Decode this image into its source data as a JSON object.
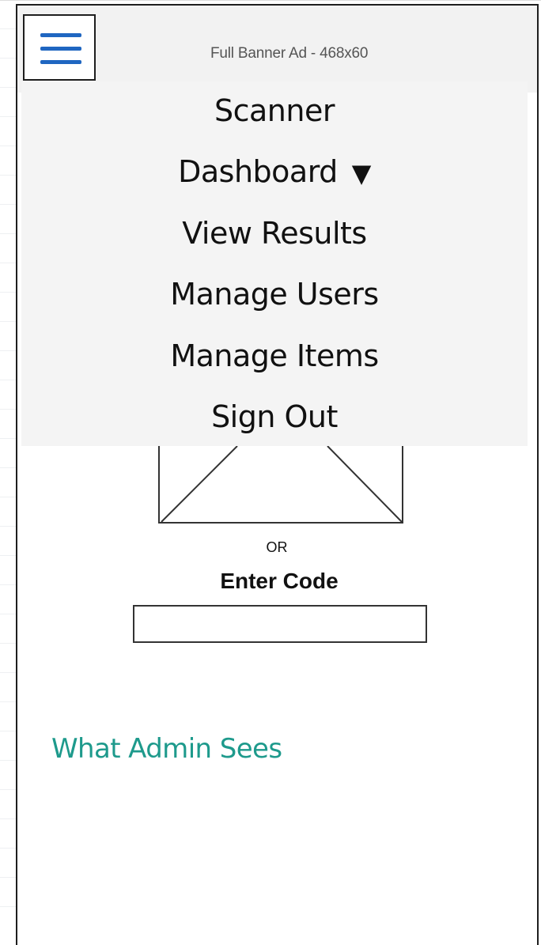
{
  "banner": {
    "text": "Full Banner Ad - 468x60"
  },
  "menu": {
    "items": [
      {
        "label": "Scanner",
        "has_caret": false
      },
      {
        "label": "Dashboard",
        "has_caret": true
      },
      {
        "label": "View Results",
        "has_caret": false
      },
      {
        "label": "Manage Users",
        "has_caret": false
      },
      {
        "label": "Manage Items",
        "has_caret": false
      },
      {
        "label": "Sign Out",
        "has_caret": false
      }
    ],
    "caret_glyph": "▼"
  },
  "scan": {
    "or_label": "OR",
    "enter_code_label": "Enter Code",
    "code_input_value": "",
    "code_input_placeholder": ""
  },
  "footer": {
    "admin_link": "What Admin Sees"
  },
  "colors": {
    "hamburger": "#1f66c1",
    "link": "#1e9a8c",
    "menu_bg": "#f4f4f4",
    "banner_bg": "#f2f2f2"
  },
  "icons": {
    "menu": "hamburger-menu-icon",
    "dropdown": "caret-down-icon",
    "image": "image-placeholder-icon"
  }
}
